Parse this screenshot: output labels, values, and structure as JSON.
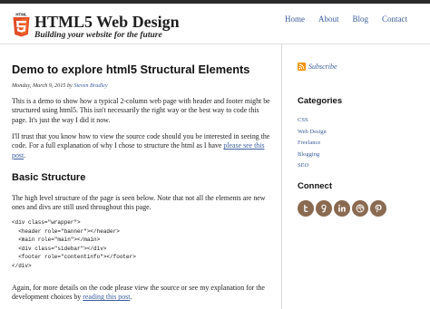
{
  "site": {
    "logo_text": "HTML",
    "title": "HTML5 Web Design",
    "tagline": "Building your website for the future"
  },
  "nav": {
    "items": [
      "Home",
      "About",
      "Blog",
      "Contact"
    ]
  },
  "post": {
    "title": "Demo to explore html5 Structural Elements",
    "date": "Monday, March 9, 2015 by",
    "author": "Steven Bradley",
    "para1": "This is a demo to show how a typical 2-column web page with header and footer might be structured using html5. This isn't necessarily the right way or the best way to code this page. It's just the way I did it now.",
    "para2_text": "I'll trust that you know how to view the source code should you be interested in seeing the code. For a full explanation of why I chose to structure the html as I have",
    "para2_link": "please see this post",
    "para2_end": ".",
    "section_heading": "Basic Structure",
    "para3": "The high level structure of the page is seen below. Note that not all the elements are new ones and divs are still used throughout this page.",
    "code": "<div class=\"wrapper\">\n  <header role=\"banner\"></header>\n  <main role=\"main\"></main>\n  <div class=\"sidebar\"></div>\n  <footer role=\"contentinfo\"></footer>\n</div>",
    "para4_text": "Again, for more details on the code please view the source or see my explanation for the development choices by",
    "para4_link": "reading this post",
    "para4_end": "."
  },
  "sidebar": {
    "subscribe": "Subscribe",
    "categories_heading": "Categories",
    "categories": [
      "CSS",
      "Web Design",
      "Freelance",
      "Blogging",
      "SEO"
    ],
    "connect_heading": "Connect",
    "social_icons": [
      "twitter-icon",
      "google-plus-icon",
      "linkedin-icon",
      "dribbble-icon",
      "pinterest-icon"
    ]
  },
  "colors": {
    "link": "#3a5d9c",
    "html5_orange": "#e44d26",
    "rss_orange": "#f39200",
    "social_brown": "#8a6a50",
    "topbar": "#2b2b2b"
  }
}
